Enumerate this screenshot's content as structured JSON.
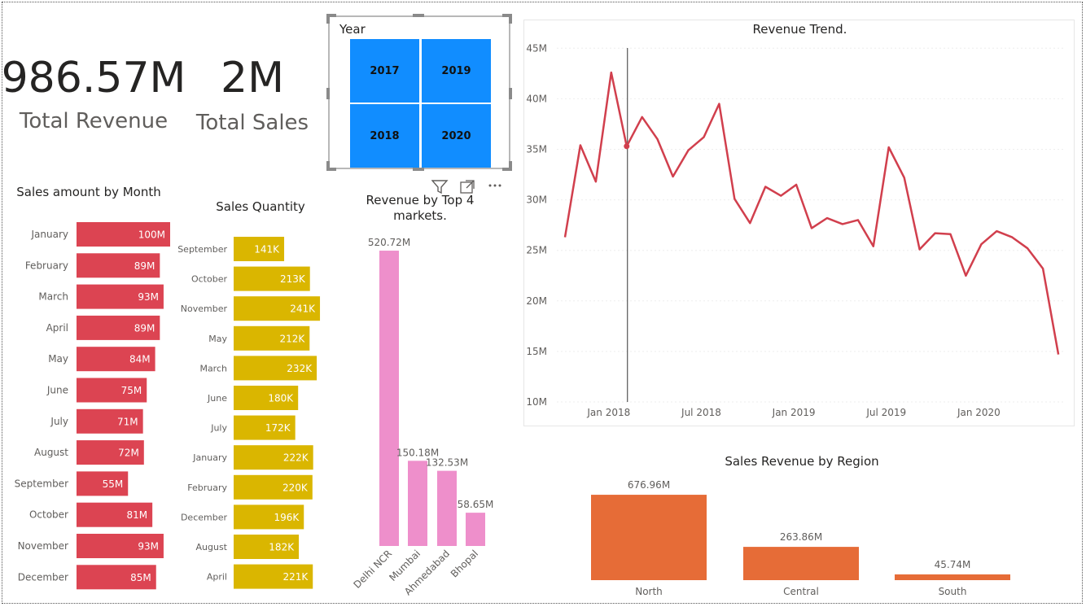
{
  "kpis": {
    "revenue": {
      "value": "986.57M",
      "label": "Total Revenue"
    },
    "sales": {
      "value": "2M",
      "label": "Total Sales"
    }
  },
  "slicer": {
    "title": "Year",
    "options": [
      "2017",
      "2019",
      "2018",
      "2020"
    ]
  },
  "colors": {
    "month_bars": "#dc4452",
    "quantity_bars": "#dab600",
    "market_bars": "#ee8fcb",
    "region_bars": "#e66c37",
    "trend_line": "#d13f4d",
    "slicer_tiles": "#118dff"
  },
  "icons": {
    "filter": "filter-icon",
    "focus": "focus-mode-icon",
    "more": "more-options-icon"
  },
  "chart_data": [
    {
      "id": "month",
      "type": "bar",
      "title": "Sales amount by Month",
      "orientation": "horizontal",
      "categories": [
        "January",
        "February",
        "March",
        "April",
        "May",
        "June",
        "July",
        "August",
        "September",
        "October",
        "November",
        "December"
      ],
      "values": [
        100,
        89,
        93,
        89,
        84,
        75,
        71,
        72,
        55,
        81,
        93,
        85
      ],
      "labels": [
        "100M",
        "89M",
        "93M",
        "89M",
        "84M",
        "75M",
        "71M",
        "72M",
        "55M",
        "81M",
        "93M",
        "85M"
      ],
      "unit": "M"
    },
    {
      "id": "quantity",
      "type": "bar",
      "title": "Sales Quantity",
      "orientation": "horizontal",
      "categories": [
        "September",
        "October",
        "November",
        "May",
        "March",
        "June",
        "July",
        "January",
        "February",
        "December",
        "August",
        "April"
      ],
      "values": [
        141,
        213,
        241,
        212,
        232,
        180,
        172,
        222,
        220,
        196,
        182,
        221
      ],
      "labels": [
        "141K",
        "213K",
        "241K",
        "212K",
        "232K",
        "180K",
        "172K",
        "222K",
        "220K",
        "196K",
        "182K",
        "221K"
      ],
      "unit": "K"
    },
    {
      "id": "markets",
      "type": "bar",
      "title": "Revenue by Top 4 markets.",
      "categories": [
        "Delhi NCR",
        "Mumbai",
        "Ahmedabad",
        "Bhopal"
      ],
      "values": [
        520.72,
        150.18,
        132.53,
        58.65
      ],
      "labels": [
        "520.72M",
        "150.18M",
        "132.53M",
        "58.65M"
      ],
      "unit": "M"
    },
    {
      "id": "trend",
      "type": "line",
      "title": "Revenue Trend.",
      "x": [
        "2017-10",
        "2017-11",
        "2017-12",
        "2018-01",
        "2018-02",
        "2018-03",
        "2018-04",
        "2018-05",
        "2018-06",
        "2018-07",
        "2018-08",
        "2018-09",
        "2018-10",
        "2018-11",
        "2018-12",
        "2019-01",
        "2019-02",
        "2019-03",
        "2019-04",
        "2019-05",
        "2019-06",
        "2019-07",
        "2019-08",
        "2019-09",
        "2019-10",
        "2019-11",
        "2019-12",
        "2020-01",
        "2020-02",
        "2020-03",
        "2020-04",
        "2020-05",
        "2020-06"
      ],
      "values": [
        26.3,
        35.4,
        31.8,
        42.6,
        35.3,
        38.2,
        36.0,
        32.3,
        34.9,
        36.2,
        39.5,
        30.1,
        27.7,
        31.3,
        30.4,
        31.5,
        27.2,
        28.2,
        27.6,
        28.0,
        25.4,
        35.2,
        32.2,
        25.1,
        26.7,
        26.6,
        22.5,
        25.6,
        26.9,
        26.3,
        25.2,
        23.2,
        14.7
      ],
      "xticks": [
        "Jan 2018",
        "Jul 2018",
        "Jan 2019",
        "Jul 2019",
        "Jan 2020"
      ],
      "yticks": [
        "10M",
        "15M",
        "20M",
        "25M",
        "30M",
        "35M",
        "40M",
        "45M"
      ],
      "ylim": [
        10,
        45
      ],
      "unit": "M"
    },
    {
      "id": "region",
      "type": "bar",
      "title": "Sales Revenue by Region",
      "categories": [
        "North",
        "Central",
        "South"
      ],
      "values": [
        676.96,
        263.86,
        45.74
      ],
      "labels": [
        "676.96M",
        "263.86M",
        "45.74M"
      ],
      "unit": "M"
    }
  ]
}
